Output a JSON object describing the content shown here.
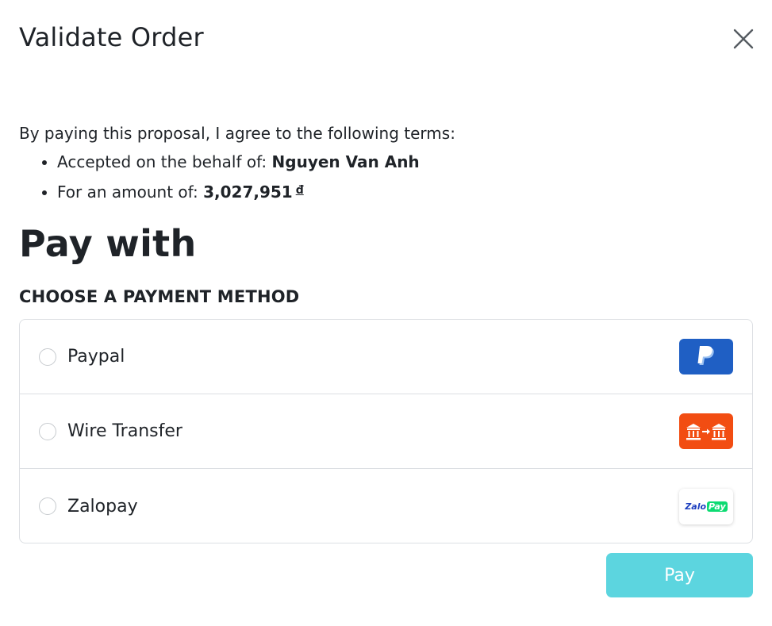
{
  "dialog": {
    "title": "Validate Order"
  },
  "terms": {
    "intro": "By paying this proposal, I agree to the following terms:",
    "behalf_label": "Accepted on the behalf of: ",
    "behalf_name": "Nguyen Van Anh",
    "amount_label": "For an amount of: ",
    "amount_value": "3,027,951",
    "currency": "đ"
  },
  "payment": {
    "heading": "Pay with",
    "subheading": "CHOOSE A PAYMENT METHOD",
    "methods": [
      {
        "label": "Paypal",
        "icon": "paypal-logo",
        "color": "#1f5fc4",
        "selected": false
      },
      {
        "label": "Wire Transfer",
        "icon": "bank-transfer-icon",
        "color": "#f24d12",
        "selected": false
      },
      {
        "label": "Zalopay",
        "icon": "zalopay-logo",
        "logo_text_1": "Zalo",
        "logo_text_2": "Pay",
        "selected": false
      }
    ],
    "pay_button": "Pay",
    "pay_button_color": "#5cd5df"
  }
}
